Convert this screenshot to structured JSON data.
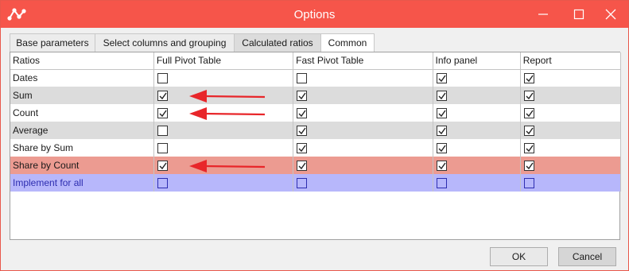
{
  "window": {
    "title": "Options",
    "title_bar_color": "#f6554a"
  },
  "tabs": [
    {
      "label": "Base parameters",
      "active": false
    },
    {
      "label": "Select columns and grouping",
      "active": false
    },
    {
      "label": "Calculated ratios",
      "active": true
    },
    {
      "label": "Common",
      "active": false
    }
  ],
  "table": {
    "columns": [
      "Ratios",
      "Full Pivot Table",
      "Fast Pivot Table",
      "Info panel",
      "Report"
    ],
    "rows": [
      {
        "label": "Dates",
        "values": [
          false,
          false,
          true,
          true
        ],
        "highlight": "none",
        "annotated": false
      },
      {
        "label": "Sum",
        "values": [
          true,
          true,
          true,
          true
        ],
        "highlight": "gray",
        "annotated": true
      },
      {
        "label": "Count",
        "values": [
          true,
          true,
          true,
          true
        ],
        "highlight": "none",
        "annotated": true
      },
      {
        "label": "Average",
        "values": [
          false,
          true,
          true,
          true
        ],
        "highlight": "gray",
        "annotated": false
      },
      {
        "label": "Share by Sum",
        "values": [
          false,
          true,
          true,
          true
        ],
        "highlight": "none",
        "annotated": false
      },
      {
        "label": "Share by Count",
        "values": [
          true,
          true,
          true,
          true
        ],
        "highlight": "red",
        "annotated": true
      },
      {
        "label": "Implement for all",
        "values": [
          false,
          false,
          false,
          false
        ],
        "highlight": "blue",
        "annotated": false
      }
    ]
  },
  "annotation_arrow_color": "#e8262a",
  "footer": {
    "ok_label": "OK",
    "cancel_label": "Cancel"
  },
  "icons": {
    "app": "app-logo-icon",
    "minimize": "minimize-icon",
    "maximize": "maximize-icon",
    "close": "close-icon",
    "checkbox": "checkmark-icon",
    "arrow": "red-arrow-icon"
  }
}
